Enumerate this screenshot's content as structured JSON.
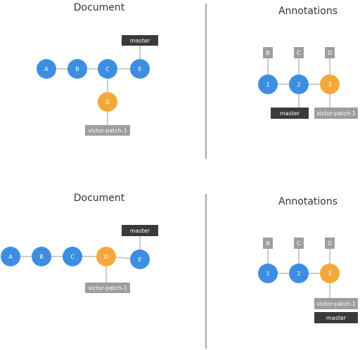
{
  "top": {
    "document": {
      "title": "Document",
      "nodes": [
        "A",
        "B",
        "C",
        "D",
        "E"
      ],
      "tags": {
        "master": "master",
        "patch": "victor-patch-1"
      }
    },
    "annotations": {
      "title": "Annotations",
      "nodes": [
        "1",
        "2",
        "3"
      ],
      "refs": [
        "B",
        "C",
        "D"
      ],
      "tags": {
        "master": "master",
        "patch": "victor-patch-1"
      }
    }
  },
  "bottom": {
    "document": {
      "title": "Document",
      "nodes": [
        "A",
        "B",
        "C",
        "D",
        "E"
      ],
      "tags": {
        "master": "master",
        "patch": "victor-patch-1"
      }
    },
    "annotations": {
      "title": "Annotations",
      "nodes": [
        "1",
        "2",
        "3"
      ],
      "refs": [
        "B",
        "C",
        "D"
      ],
      "tags": {
        "patch": "victor-patch-1",
        "master": "master"
      }
    }
  },
  "colors": {
    "blue": "#3d8ee0",
    "orange": "#f5a83a",
    "dark_tag": "#3a3a3a",
    "gray_tag": "#9e9e9e",
    "link": "#cccccc"
  }
}
